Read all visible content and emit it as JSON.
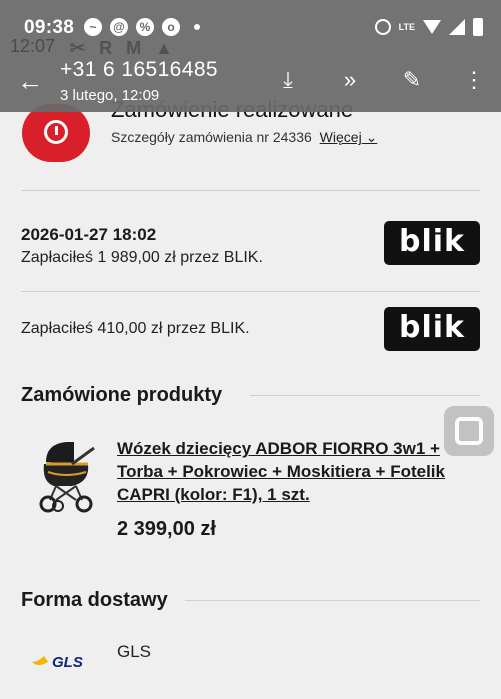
{
  "status_bar": {
    "time": "09:38",
    "ghost_time": "12:07",
    "lte_label": "LTE",
    "ghost_icons": [
      "✂",
      "R",
      "M",
      "▲"
    ]
  },
  "app_bar": {
    "phone_number": "+31 6 16516485",
    "call_date": "3 lutego, 12:09"
  },
  "order": {
    "title": "Zamówienie realizowane",
    "details_text": "Szczegóły zamówienia nr 24336",
    "more_link": "Więcej",
    "accent_color": "#d81f2a"
  },
  "payments": [
    {
      "date": "2026-01-27 18:02",
      "text": "Zapłaciłeś 1 989,00 zł przez BLIK.",
      "logo": "blik"
    },
    {
      "date": "",
      "text": "Zapłaciłeś 410,00 zł przez BLIK.",
      "logo": "blik"
    }
  ],
  "products": {
    "section_title": "Zamówione produkty",
    "items": [
      {
        "name": "Wózek dziecięcy ADBOR FIORRO 3w1 + Torba + Pokrowiec + Moskitiera + Fotelik CAPRI (kolor: F1), 1 szt.",
        "price": "2 399,00 zł"
      }
    ]
  },
  "delivery": {
    "section_title": "Forma dostawy",
    "method": "GLS",
    "logo_text": "GLS"
  }
}
